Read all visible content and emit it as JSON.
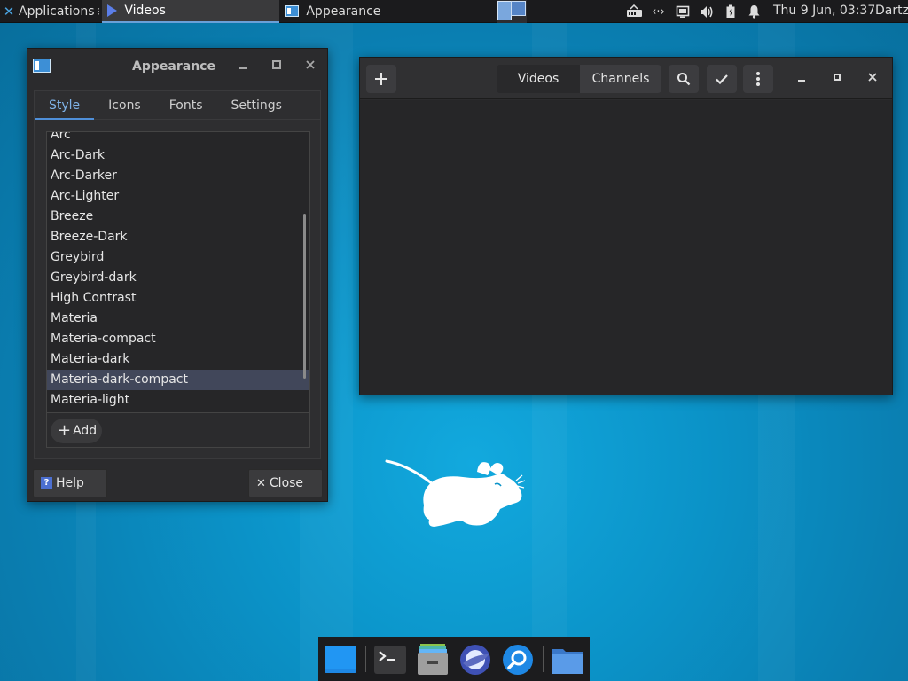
{
  "top_panel": {
    "applications_label": "Applications",
    "tasks": [
      {
        "label": "Videos"
      },
      {
        "label": "Appearance"
      }
    ],
    "clock": "Thu  9 Jun, 03:37",
    "user": "Dartz"
  },
  "appearance": {
    "title": "Appearance",
    "tabs": [
      "Style",
      "Icons",
      "Fonts",
      "Settings"
    ],
    "themes": [
      "Arc",
      "Arc-Dark",
      "Arc-Darker",
      "Arc-Lighter",
      "Breeze",
      "Breeze-Dark",
      "Greybird",
      "Greybird-dark",
      "High Contrast",
      "Materia",
      "Materia-compact",
      "Materia-dark",
      "Materia-dark-compact",
      "Materia-light"
    ],
    "selected_theme": "Materia-dark-compact",
    "add_label": "Add",
    "help_label": "Help",
    "help_badge": "?",
    "close_label": "Close"
  },
  "videos": {
    "tabs": [
      "Videos",
      "Channels"
    ],
    "active_tab": "Channels"
  },
  "colors": {
    "accent": "#4f8fd8",
    "desktop": "#0b93c8",
    "panel": "#1b1b1d"
  }
}
